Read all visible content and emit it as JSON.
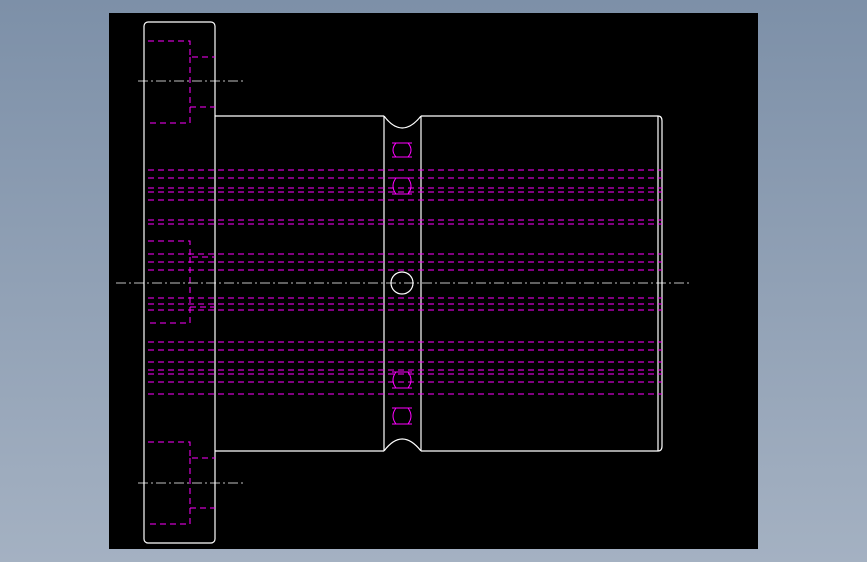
{
  "colors": {
    "background_gradient_top": "#7d90a8",
    "background_gradient_bottom": "#a4b1c2",
    "canvas": "#000000",
    "outline": "#ffffff",
    "hidden_line": "#ff00ff",
    "centerline": "#ffffff"
  },
  "drawing": {
    "views": [
      "side-view-flange",
      "front-view-body"
    ],
    "line_types": [
      "solid-outline",
      "hidden-dashed",
      "center-dash-dot"
    ]
  }
}
